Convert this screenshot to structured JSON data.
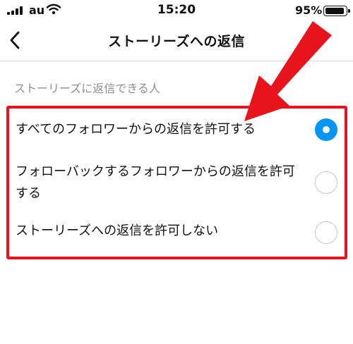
{
  "status_bar": {
    "carrier": "au",
    "time": "15:20",
    "battery_percent": "95%",
    "battery_level": 0.95,
    "icons": [
      "signal-icon",
      "wifi-icon",
      "battery-icon"
    ]
  },
  "header": {
    "title": "ストーリーズへの返信",
    "back_icon": "chevron-left-icon"
  },
  "section": {
    "label": "ストーリーズに返信できる人"
  },
  "options": [
    {
      "label": "すべてのフォロワーからの返信を許可する",
      "selected": true
    },
    {
      "label": "フォローバックするフォロワーからの返信を許可する",
      "selected": false
    },
    {
      "label": "ストーリーズへの返信を許可しない",
      "selected": false
    }
  ],
  "colors": {
    "accent": "#0095f6",
    "annotation_red": "#e8141c",
    "section_label": "#8e8e8e"
  },
  "annotation": {
    "arrow_icon": "red-arrow-icon",
    "box": "highlight-box"
  }
}
